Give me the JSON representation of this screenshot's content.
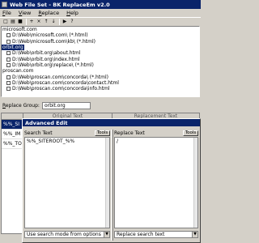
{
  "window": {
    "title": "Web File Set - BK ReplaceEm v2.0"
  },
  "menu": [
    "File",
    "View",
    "Replace",
    "Help"
  ],
  "toolbar": {
    "icons": [
      "new-icon",
      "open-icon",
      "save-icon",
      "add-icon",
      "delete-icon",
      "move-up-icon",
      "move-down-icon",
      "run-icon",
      "help-icon"
    ],
    "glyphs": [
      "□",
      "▤",
      "■",
      "+",
      "×",
      "↑",
      "↓",
      "▶",
      "?"
    ]
  },
  "groups": [
    {
      "name": "microsoft.com",
      "items": [
        "D:\\Web\\microsoft.com\\ (*.html)",
        "D:\\Web\\microsoft.com\\kb\\ (*.html)"
      ]
    },
    {
      "name": "orbit.org",
      "selected": true,
      "items": [
        "D:\\Web\\orbit.org\\about.html",
        "D:\\Web\\orbit.org\\index.html",
        "D:\\Web\\orbit.org\\replace\\ (*.html)"
      ]
    },
    {
      "name": "proscan.com",
      "items": [
        "D:\\Web\\proscan.com\\concorda\\ (*.html)",
        "D:\\Web\\proscan.com\\concorda\\contact.html",
        "D:\\Web\\proscan.com\\concorda\\info.html"
      ]
    }
  ],
  "replace_group": {
    "label": "Replace Group:",
    "value": "orbit.org"
  },
  "grid": {
    "headers": [
      "",
      "Original Text",
      "Replacement Text"
    ],
    "rows": [
      "%%_SI",
      "%%_IM",
      "%%_TO"
    ]
  },
  "edit": {
    "title": "Advanced Edit",
    "search": {
      "label": "Search Text",
      "tools": "Tools",
      "value": "%%_SITEROOT_%%",
      "mode": "Use search mode from options"
    },
    "replace": {
      "label": "Replace Text",
      "tools": "Tools",
      "value": "/",
      "mode": "Replace search text"
    }
  }
}
